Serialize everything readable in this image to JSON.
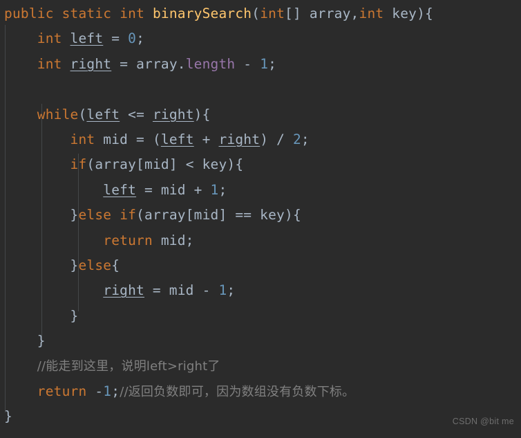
{
  "editor": {
    "language": "Java",
    "theme": "Darcula",
    "background_color": "#2b2b2b",
    "colors": {
      "keyword": "#cc7832",
      "method": "#ffc66d",
      "number": "#6897bb",
      "field": "#9876aa",
      "identifier": "#a9b7c6",
      "comment": "#808080",
      "indent_guide": "#4e5254",
      "watermark": "#6e6e6e"
    },
    "indent_guides": [
      7,
      60,
      113
    ],
    "lines": [
      {
        "id": "line-1",
        "indent": 0,
        "tokens": [
          {
            "t": "public",
            "c": "keyword"
          },
          {
            "t": " ",
            "c": "punct"
          },
          {
            "t": "static",
            "c": "keyword"
          },
          {
            "t": " ",
            "c": "punct"
          },
          {
            "t": "int",
            "c": "keyword"
          },
          {
            "t": " ",
            "c": "punct"
          },
          {
            "t": "binarySearch",
            "c": "method"
          },
          {
            "t": "(",
            "c": "punct"
          },
          {
            "t": "int",
            "c": "keyword"
          },
          {
            "t": "[] array,",
            "c": "ident"
          },
          {
            "t": "int",
            "c": "keyword"
          },
          {
            "t": " key){",
            "c": "ident"
          }
        ]
      },
      {
        "id": "line-2",
        "indent": 0,
        "tokens": [
          {
            "t": "    ",
            "c": "punct"
          },
          {
            "t": "int",
            "c": "keyword"
          },
          {
            "t": " ",
            "c": "punct"
          },
          {
            "t": "left",
            "c": "local"
          },
          {
            "t": " = ",
            "c": "ident"
          },
          {
            "t": "0",
            "c": "number"
          },
          {
            "t": ";",
            "c": "ident"
          }
        ]
      },
      {
        "id": "line-3",
        "indent": 0,
        "tokens": [
          {
            "t": "    ",
            "c": "punct"
          },
          {
            "t": "int",
            "c": "keyword"
          },
          {
            "t": " ",
            "c": "punct"
          },
          {
            "t": "right",
            "c": "local"
          },
          {
            "t": " = array.",
            "c": "ident"
          },
          {
            "t": "length",
            "c": "field"
          },
          {
            "t": " - ",
            "c": "ident"
          },
          {
            "t": "1",
            "c": "number"
          },
          {
            "t": ";",
            "c": "ident"
          }
        ]
      },
      {
        "id": "line-4",
        "indent": 0,
        "tokens": []
      },
      {
        "id": "line-5",
        "indent": 0,
        "tokens": [
          {
            "t": "    ",
            "c": "punct"
          },
          {
            "t": "while",
            "c": "keyword"
          },
          {
            "t": "(",
            "c": "ident"
          },
          {
            "t": "left",
            "c": "local"
          },
          {
            "t": " <= ",
            "c": "ident"
          },
          {
            "t": "right",
            "c": "local"
          },
          {
            "t": "){",
            "c": "ident"
          }
        ]
      },
      {
        "id": "line-6",
        "indent": 0,
        "tokens": [
          {
            "t": "        ",
            "c": "punct"
          },
          {
            "t": "int",
            "c": "keyword"
          },
          {
            "t": " mid = (",
            "c": "ident"
          },
          {
            "t": "left",
            "c": "local"
          },
          {
            "t": " + ",
            "c": "ident"
          },
          {
            "t": "right",
            "c": "local"
          },
          {
            "t": ") / ",
            "c": "ident"
          },
          {
            "t": "2",
            "c": "number"
          },
          {
            "t": ";",
            "c": "ident"
          }
        ]
      },
      {
        "id": "line-7",
        "indent": 0,
        "tokens": [
          {
            "t": "        ",
            "c": "punct"
          },
          {
            "t": "if",
            "c": "keyword"
          },
          {
            "t": "(array[mid] < key){",
            "c": "ident"
          }
        ]
      },
      {
        "id": "line-8",
        "indent": 0,
        "tokens": [
          {
            "t": "            ",
            "c": "punct"
          },
          {
            "t": "left",
            "c": "local"
          },
          {
            "t": " = mid + ",
            "c": "ident"
          },
          {
            "t": "1",
            "c": "number"
          },
          {
            "t": ";",
            "c": "ident"
          }
        ]
      },
      {
        "id": "line-9",
        "indent": 0,
        "tokens": [
          {
            "t": "        }",
            "c": "ident"
          },
          {
            "t": "else",
            "c": "keyword"
          },
          {
            "t": " ",
            "c": "punct"
          },
          {
            "t": "if",
            "c": "keyword"
          },
          {
            "t": "(array[mid] == key){",
            "c": "ident"
          }
        ]
      },
      {
        "id": "line-10",
        "indent": 0,
        "tokens": [
          {
            "t": "            ",
            "c": "punct"
          },
          {
            "t": "return",
            "c": "keyword"
          },
          {
            "t": " mid;",
            "c": "ident"
          }
        ]
      },
      {
        "id": "line-11",
        "indent": 0,
        "tokens": [
          {
            "t": "        }",
            "c": "ident"
          },
          {
            "t": "else",
            "c": "keyword"
          },
          {
            "t": "{",
            "c": "ident"
          }
        ]
      },
      {
        "id": "line-12",
        "indent": 0,
        "tokens": [
          {
            "t": "            ",
            "c": "punct"
          },
          {
            "t": "right",
            "c": "local"
          },
          {
            "t": " = mid - ",
            "c": "ident"
          },
          {
            "t": "1",
            "c": "number"
          },
          {
            "t": ";",
            "c": "ident"
          }
        ]
      },
      {
        "id": "line-13",
        "indent": 0,
        "tokens": [
          {
            "t": "        }",
            "c": "ident"
          }
        ]
      },
      {
        "id": "line-14",
        "indent": 0,
        "tokens": [
          {
            "t": "    }",
            "c": "ident"
          }
        ]
      },
      {
        "id": "line-15",
        "indent": 0,
        "tokens": [
          {
            "t": "    ",
            "c": "punct"
          },
          {
            "t": "//能走到这里，说明left>right了",
            "c": "comment",
            "cjk": true
          }
        ]
      },
      {
        "id": "line-16",
        "indent": 0,
        "tokens": [
          {
            "t": "    ",
            "c": "punct"
          },
          {
            "t": "return",
            "c": "keyword"
          },
          {
            "t": " -",
            "c": "ident"
          },
          {
            "t": "1",
            "c": "number"
          },
          {
            "t": ";",
            "c": "ident"
          },
          {
            "t": "//返回负数即可，因为数组没有负数下标。",
            "c": "comment",
            "cjk": true
          }
        ]
      },
      {
        "id": "line-17",
        "indent": 0,
        "tokens": [
          {
            "t": "}",
            "c": "ident"
          }
        ]
      }
    ]
  },
  "watermark": {
    "text": "CSDN @bit me"
  }
}
